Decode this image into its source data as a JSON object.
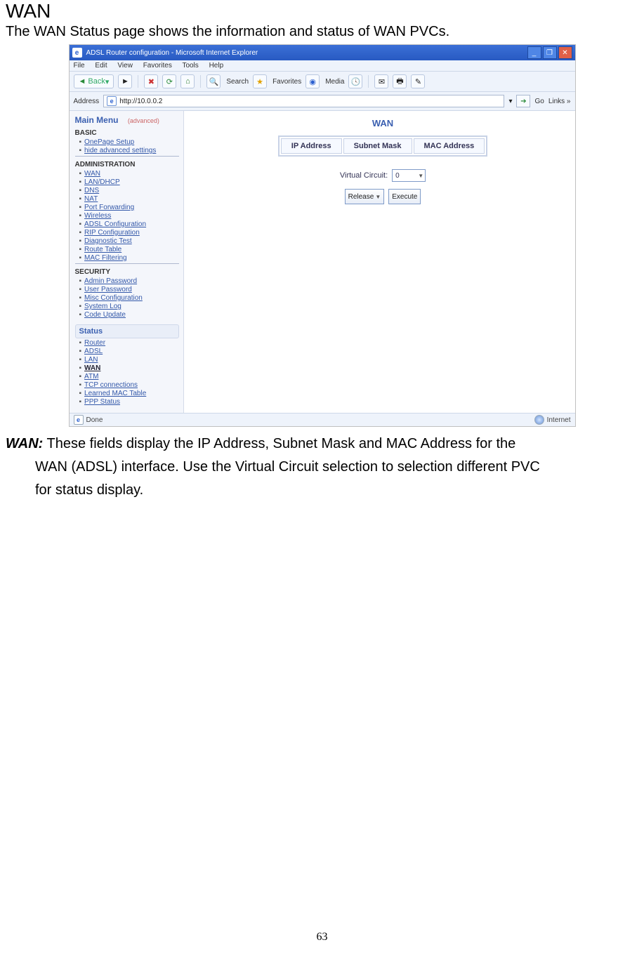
{
  "doc": {
    "title": "WAN",
    "intro": "The WAN Status page shows the information and status of WAN PVCs.",
    "body_label": "WAN:",
    "body_line1_rest": " These fields display the IP Address, Subnet Mask and MAC Address for the",
    "body_line2": "WAN (ADSL) interface. Use the Virtual Circuit selection to selection different PVC",
    "body_line3": "for status display.",
    "page_number": "63"
  },
  "browser": {
    "title": "ADSL Router configuration - Microsoft Internet Explorer",
    "menus": [
      "File",
      "Edit",
      "View",
      "Favorites",
      "Tools",
      "Help"
    ],
    "back_label": "Back",
    "search_label": "Search",
    "favorites_label": "Favorites",
    "media_label": "Media",
    "address_label": "Address",
    "address_value": "http://10.0.0.2",
    "go_label": "Go",
    "links_label": "Links »",
    "status_done": "Done",
    "status_zone": "Internet"
  },
  "sidebar": {
    "main_menu": "Main Menu",
    "main_menu_sub": "(advanced)",
    "basic_label": "BASIC",
    "basic_items": [
      "OnePage Setup",
      "hide advanced settings"
    ],
    "admin_label": "ADMINISTRATION",
    "admin_items": [
      "WAN",
      "LAN/DHCP",
      "DNS",
      "NAT",
      "Port Forwarding",
      "Wireless",
      "ADSL Configuration",
      "RIP Configuration",
      "Diagnostic Test",
      "Route Table",
      "MAC Filtering"
    ],
    "security_label": "SECURITY",
    "security_items": [
      "Admin Password",
      "User Password",
      "Misc Configuration",
      "System Log",
      "Code Update"
    ],
    "status_label": "Status",
    "status_items": [
      "Router",
      "ADSL",
      "LAN",
      "WAN",
      "ATM",
      "TCP connections",
      "Learned MAC Table",
      "PPP Status"
    ],
    "selected_status": "WAN"
  },
  "wanpanel": {
    "heading": "WAN",
    "cols": [
      "IP Address",
      "Subnet Mask",
      "MAC Address"
    ],
    "vc_label": "Virtual Circuit:",
    "vc_value": "0",
    "release_label": "Release",
    "execute_label": "Execute"
  }
}
